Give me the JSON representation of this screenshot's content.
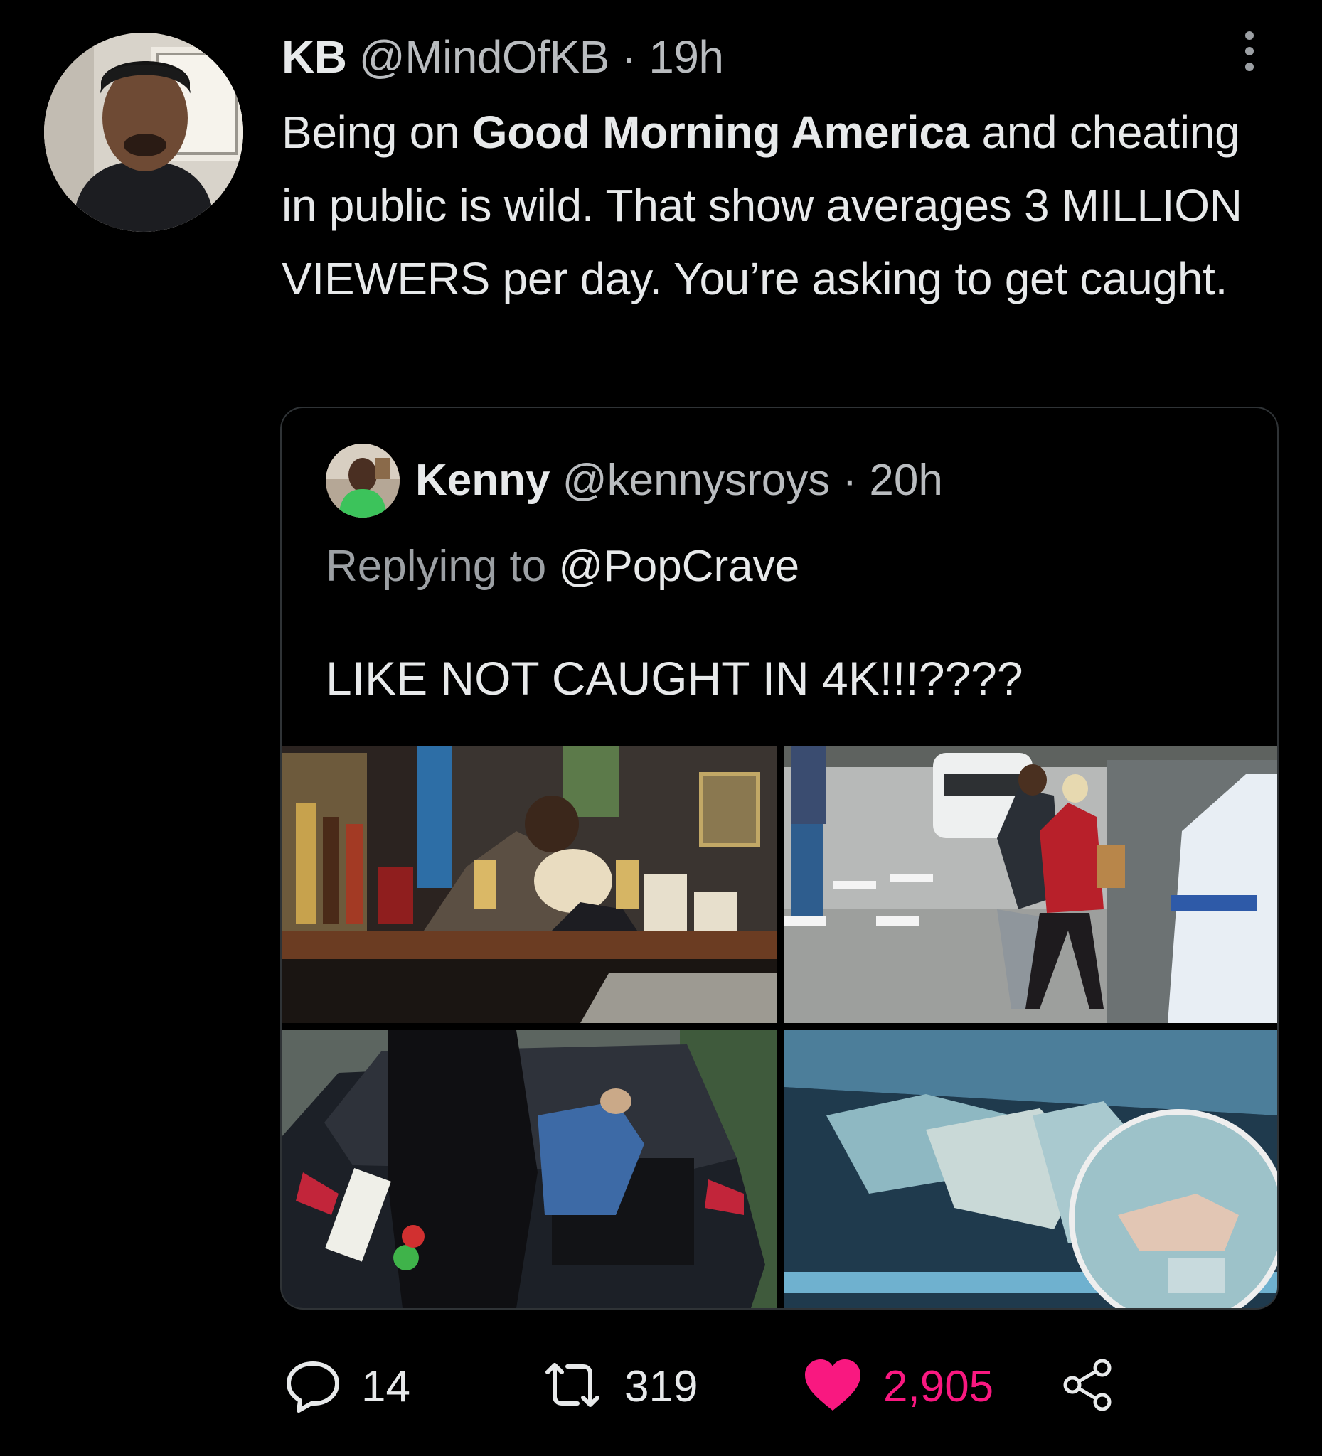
{
  "tweet": {
    "name": "KB",
    "handle": "@MindOfKB",
    "separator": "·",
    "time": "19h",
    "text_before": "Being on ",
    "text_bold": "Good Morning America",
    "text_after": " and cheating in public is wild. That show averages 3 MILLION VIEWERS per day. You’re asking to get caught."
  },
  "quote": {
    "name": "Kenny",
    "handle": "@kennysroys",
    "separator": "·",
    "time": "20h",
    "replying_prefix": "Replying to ",
    "replying_to": "@PopCrave",
    "text": "LIKE NOT CAUGHT IN 4K!!!????"
  },
  "actions": {
    "replies": "14",
    "retweets": "319",
    "likes": "2,905"
  },
  "colors": {
    "background": "#000000",
    "text": "#e7e9ea",
    "muted": "#9ca0a4",
    "like": "#f91880",
    "border": "#2f3336"
  },
  "icons": [
    "more-icon",
    "reply-icon",
    "retweet-icon",
    "heart-icon",
    "share-icon"
  ]
}
